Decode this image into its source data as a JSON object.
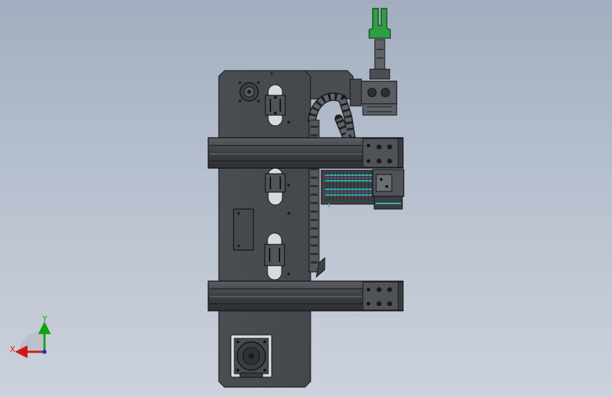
{
  "viewport": {
    "background_top": "#a2aebf",
    "background_bottom": "#ccd2dc"
  },
  "model": {
    "plate_color": "#484b4f",
    "rail_color": "#3f4247",
    "highlight_color": "#2fb8ad",
    "gripper_color": "#2ea043"
  },
  "triad": {
    "x_label": "X",
    "y_label": "Y",
    "x_color": "#d01818",
    "y_color": "#13a113",
    "z_color": "#1c35c9"
  }
}
